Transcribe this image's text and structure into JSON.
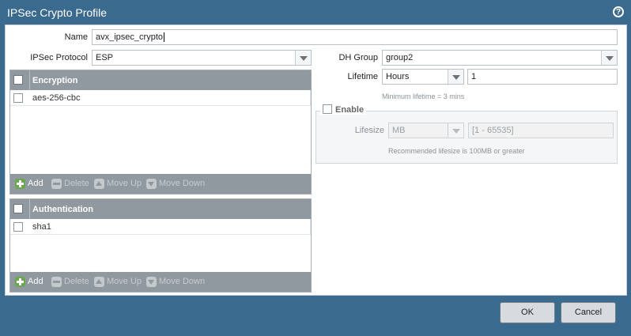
{
  "dialog": {
    "title": "IPSec Crypto Profile",
    "help_icon": "help-icon"
  },
  "form": {
    "name_label": "Name",
    "name_value": "avx_ipsec_crypto",
    "protocol_label": "IPSec Protocol",
    "protocol_value": "ESP",
    "dh_group_label": "DH Group",
    "dh_group_value": "group2",
    "lifetime_label": "Lifetime",
    "lifetime_unit": "Hours",
    "lifetime_value": "1",
    "lifetime_hint": "Minimum lifetime = 3 mins"
  },
  "encryption": {
    "header": "Encryption",
    "rows": [
      "aes-256-cbc"
    ],
    "toolbar": {
      "add": "Add",
      "delete": "Delete",
      "move_up": "Move Up",
      "move_down": "Move Down"
    }
  },
  "authentication": {
    "header": "Authentication",
    "rows": [
      "sha1"
    ],
    "toolbar": {
      "add": "Add",
      "delete": "Delete",
      "move_up": "Move Up",
      "move_down": "Move Down"
    }
  },
  "lifesize": {
    "enable_label": "Enable",
    "label": "Lifesize",
    "unit": "MB",
    "placeholder": "[1 - 65535]",
    "hint": "Recommended lifesize is 100MB or greater"
  },
  "buttons": {
    "ok": "OK",
    "cancel": "Cancel"
  }
}
